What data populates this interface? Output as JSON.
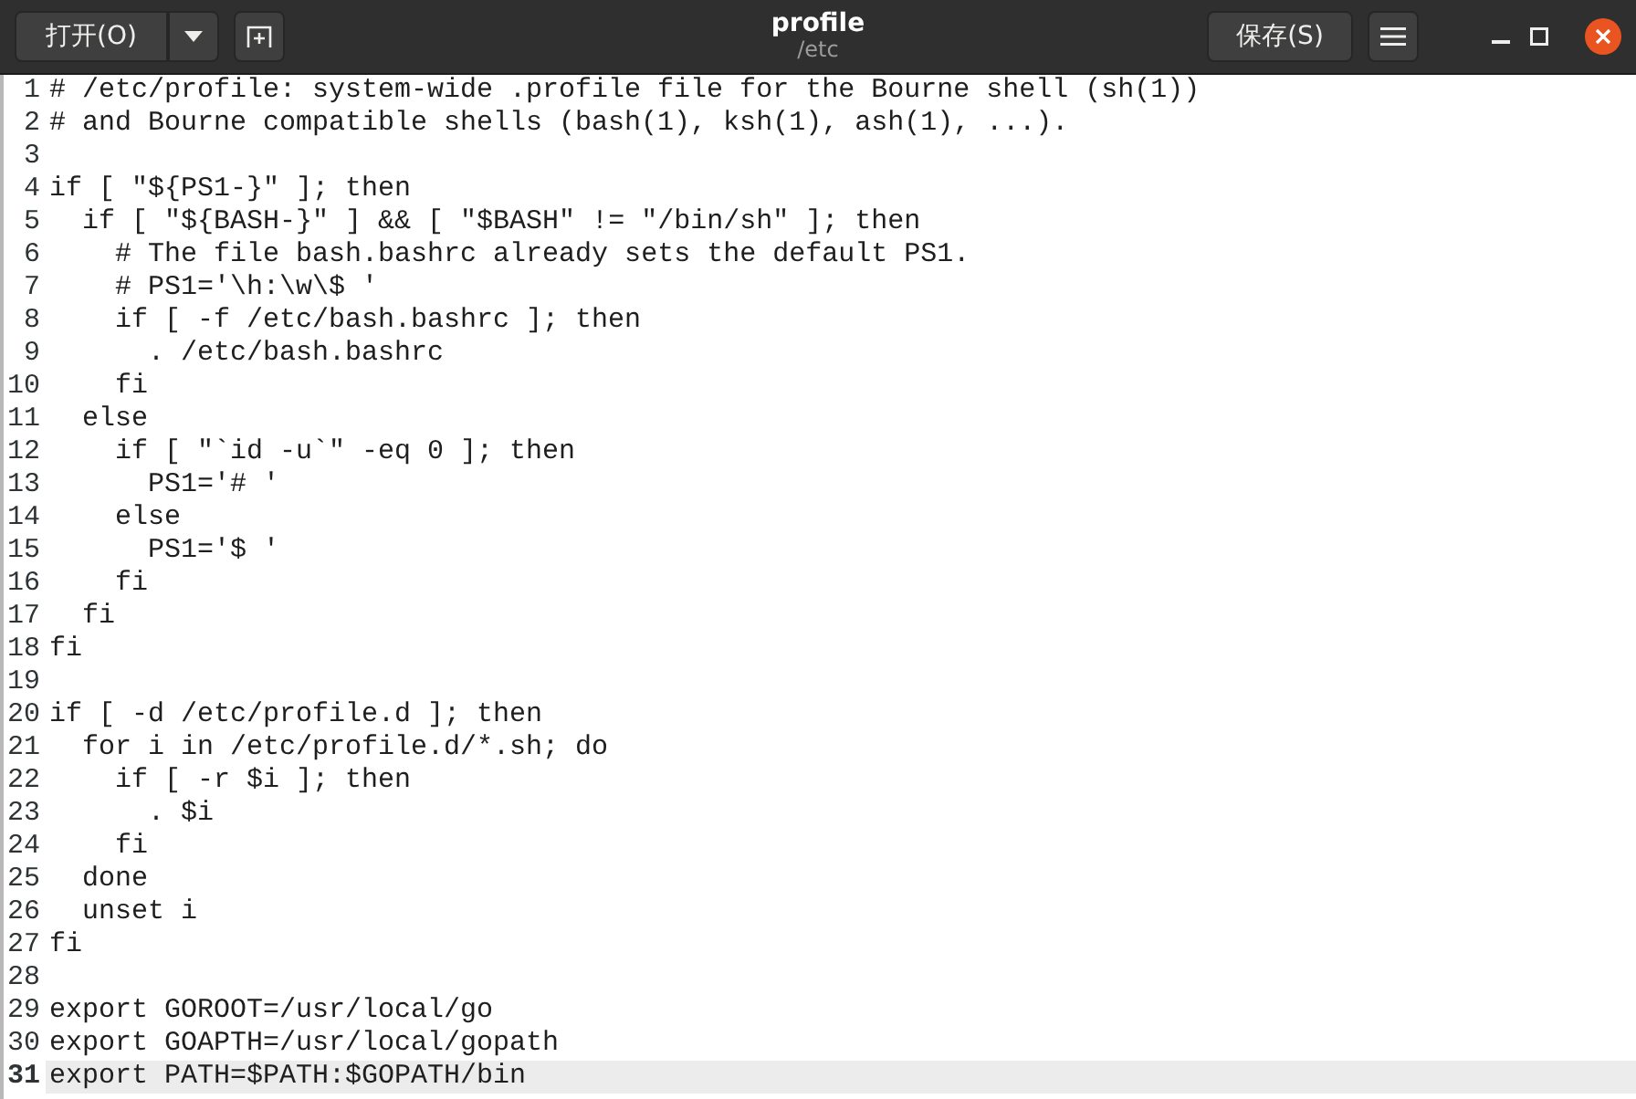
{
  "window": {
    "title": "profile",
    "subtitle": "/etc"
  },
  "header": {
    "open_button": {
      "label": "打开(O)"
    },
    "save_button": {
      "label": "保存(S)"
    }
  },
  "lines": [
    {
      "number": "1",
      "text": "# /etc/profile: system-wide .profile file for the Bourne shell (sh(1))",
      "current": false
    },
    {
      "number": "2",
      "text": "# and Bourne compatible shells (bash(1), ksh(1), ash(1), ...).",
      "current": false
    },
    {
      "number": "3",
      "current": false
    },
    {
      "number": "4",
      "text": "if [ \"${PS1-}\" ]; then",
      "current": false
    },
    {
      "number": "5",
      "text": "  if [ \"${BASH-}\" ] && [ \"$BASH\" != \"/bin/sh\" ]; then",
      "current": false
    },
    {
      "number": "6",
      "text": "    # The file bash.bashrc already sets the default PS1.",
      "current": false
    },
    {
      "number": "7",
      "text": "    # PS1='\\h:\\w\\$ '",
      "current": false
    },
    {
      "number": "8",
      "text": "    if [ -f /etc/bash.bashrc ]; then",
      "current": false
    },
    {
      "number": "9",
      "text": "      . /etc/bash.bashrc",
      "current": false
    },
    {
      "number": "10",
      "text": "    fi",
      "current": false
    },
    {
      "number": "11",
      "text": "  else",
      "current": false
    },
    {
      "number": "12",
      "text": "    if [ \"`id -u`\" -eq 0 ]; then",
      "current": false
    },
    {
      "number": "13",
      "text": "      PS1='# '",
      "current": false
    },
    {
      "number": "14",
      "text": "    else",
      "current": false
    },
    {
      "number": "15",
      "text": "      PS1='$ '",
      "current": false
    },
    {
      "number": "16",
      "text": "    fi",
      "current": false
    },
    {
      "number": "17",
      "text": "  fi",
      "current": false
    },
    {
      "number": "18",
      "text": "fi",
      "current": false
    },
    {
      "number": "19",
      "current": false
    },
    {
      "number": "20",
      "text": "if [ -d /etc/profile.d ]; then",
      "current": false
    },
    {
      "number": "21",
      "text": "  for i in /etc/profile.d/*.sh; do",
      "current": false
    },
    {
      "number": "22",
      "text": "    if [ -r $i ]; then",
      "current": false
    },
    {
      "number": "23",
      "text": "      . $i",
      "current": false
    },
    {
      "number": "24",
      "text": "    fi",
      "current": false
    },
    {
      "number": "25",
      "text": "  done",
      "current": false
    },
    {
      "number": "26",
      "text": "  unset i",
      "current": false
    },
    {
      "number": "27",
      "text": "fi",
      "current": false
    },
    {
      "number": "28",
      "current": false
    },
    {
      "number": "29",
      "text": "export GOROOT=/usr/local/go",
      "current": false
    },
    {
      "number": "30",
      "text": "export GOAPTH=/usr/local/gopath",
      "current": false
    },
    {
      "number": "31",
      "text": "export PATH=$PATH:$GOPATH/bin",
      "current": true
    }
  ]
}
